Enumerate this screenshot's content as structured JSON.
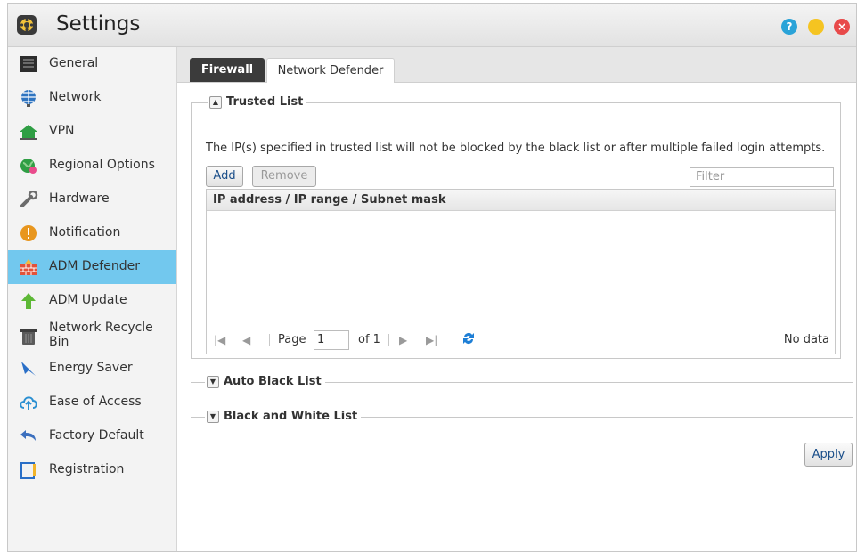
{
  "window": {
    "title": "Settings",
    "controls": {
      "help": "?",
      "minimize": "",
      "close": "×"
    }
  },
  "sidebar": {
    "items": [
      {
        "label": "General",
        "icon": "general-icon"
      },
      {
        "label": "Network",
        "icon": "network-globe-icon"
      },
      {
        "label": "VPN",
        "icon": "vpn-icon"
      },
      {
        "label": "Regional Options",
        "icon": "regional-options-icon"
      },
      {
        "label": "Hardware",
        "icon": "hardware-wrench-icon"
      },
      {
        "label": "Notification",
        "icon": "notification-alert-icon"
      },
      {
        "label": "ADM Defender",
        "icon": "defender-wall-icon",
        "active": true
      },
      {
        "label": "ADM Update",
        "icon": "update-arrow-icon"
      },
      {
        "label": "Network Recycle Bin",
        "icon": "recycle-bin-icon"
      },
      {
        "label": "Energy Saver",
        "icon": "energy-saver-icon"
      },
      {
        "label": "Ease of Access",
        "icon": "cloud-upload-icon"
      },
      {
        "label": "Factory Default",
        "icon": "undo-arrow-icon"
      },
      {
        "label": "Registration",
        "icon": "registration-icon"
      }
    ]
  },
  "tabs": [
    {
      "label": "Firewall",
      "active": true
    },
    {
      "label": "Network Defender",
      "active": false
    }
  ],
  "trusted_list": {
    "title": "Trusted List",
    "description": "The IP(s) specified in trusted list will not be blocked by the black list or after multiple failed login attempts.",
    "add_label": "Add",
    "remove_label": "Remove",
    "filter_placeholder": "Filter",
    "column_header": "IP address / IP range / Subnet mask",
    "rows": [],
    "pager": {
      "page_label": "Page",
      "page_value": "1",
      "of_label": "of 1",
      "status": "No data"
    }
  },
  "sections": {
    "auto_black_list": "Auto Black List",
    "black_white_list": "Black and White List"
  },
  "apply_label": "Apply",
  "colors": {
    "active_item": "#72c8ee",
    "active_tab": "#3b3b3b",
    "link_blue": "#1b4f8a"
  }
}
